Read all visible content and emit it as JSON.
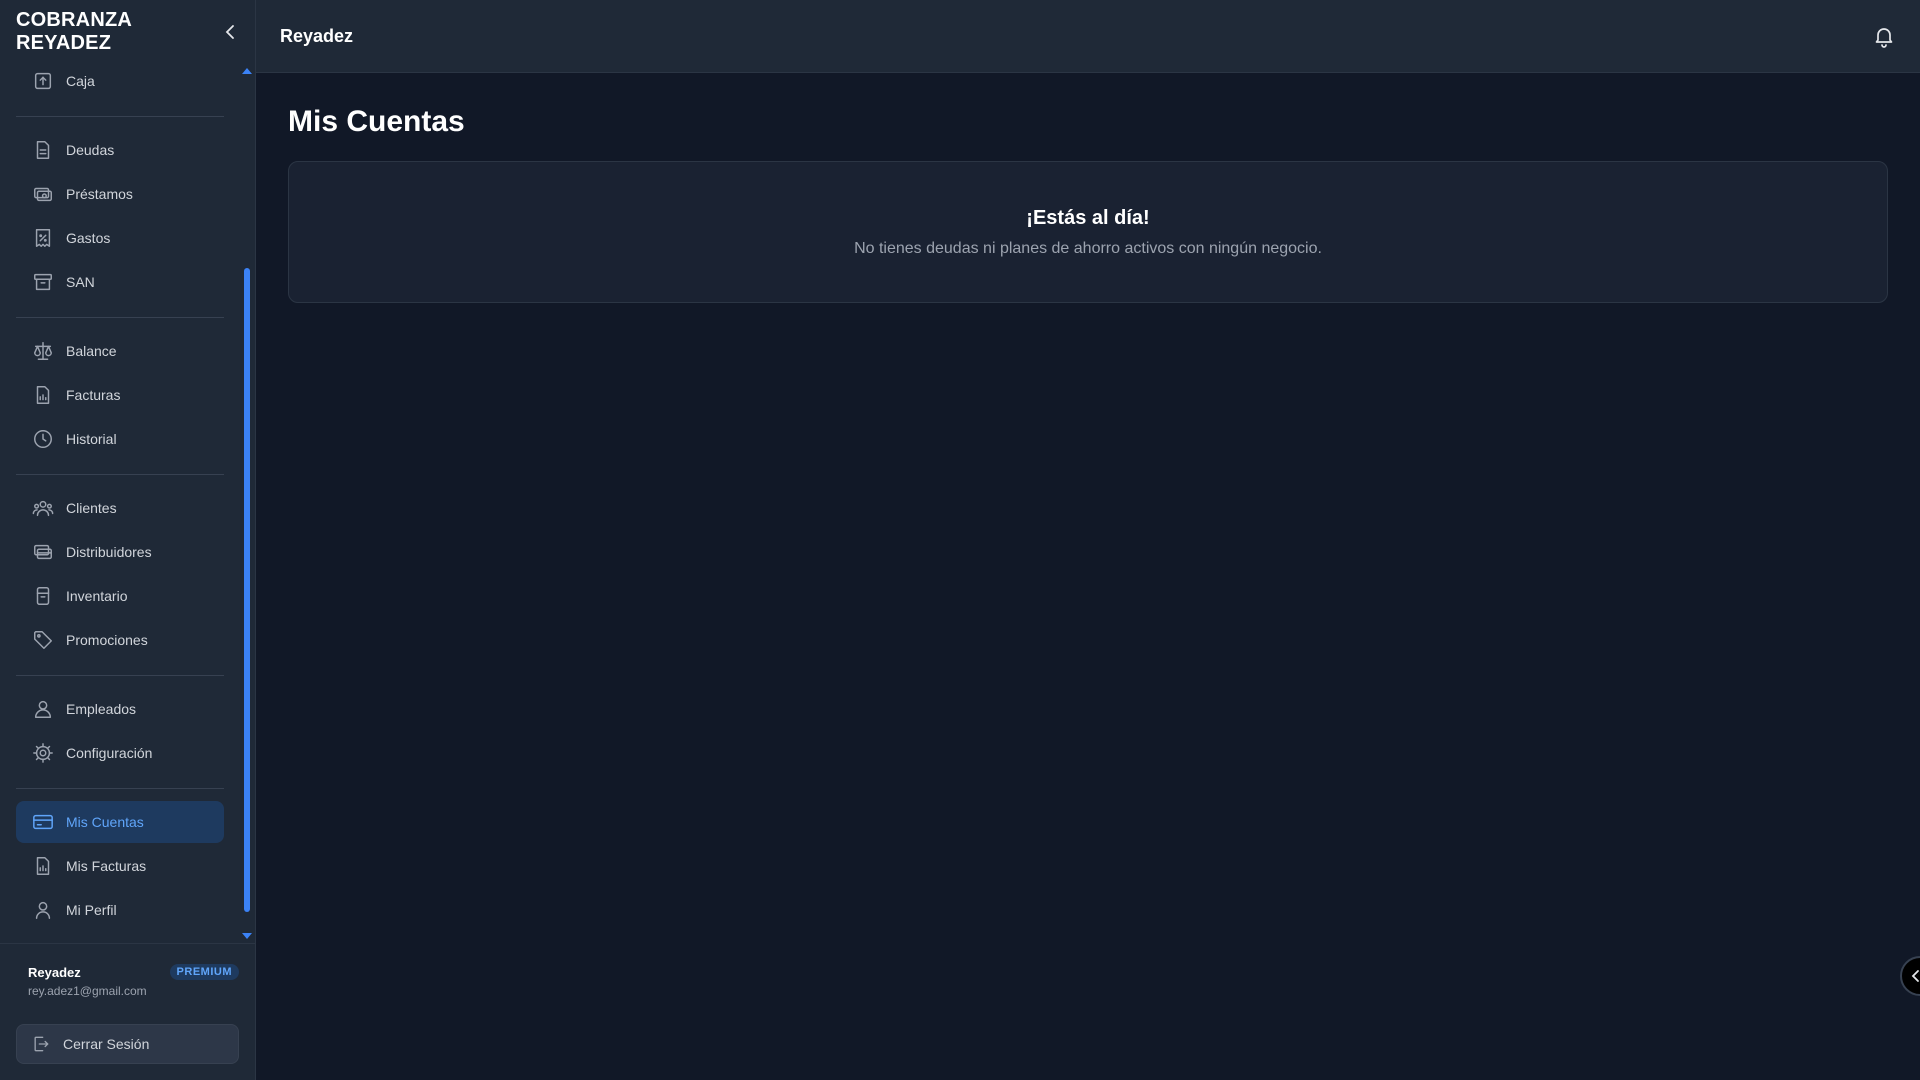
{
  "brand": {
    "title": "COBRANZA REYADEZ"
  },
  "topbar": {
    "title": "Reyadez"
  },
  "sidebar": {
    "groups": [
      [
        {
          "label": "Caja",
          "icon": "cash-register-icon"
        }
      ],
      [
        {
          "label": "Deudas",
          "icon": "document-icon"
        },
        {
          "label": "Préstamos",
          "icon": "money-icon"
        },
        {
          "label": "Gastos",
          "icon": "receipt-icon"
        },
        {
          "label": "SAN",
          "icon": "archive-icon"
        }
      ],
      [
        {
          "label": "Balance",
          "icon": "scale-icon"
        },
        {
          "label": "Facturas",
          "icon": "invoice-chart-icon"
        },
        {
          "label": "Historial",
          "icon": "clock-icon"
        }
      ],
      [
        {
          "label": "Clientes",
          "icon": "users-icon"
        },
        {
          "label": "Distribuidores",
          "icon": "cards-icon"
        },
        {
          "label": "Inventario",
          "icon": "box-icon"
        },
        {
          "label": "Promociones",
          "icon": "tag-icon"
        }
      ],
      [
        {
          "label": "Empleados",
          "icon": "employee-icon"
        },
        {
          "label": "Configuración",
          "icon": "gear-icon"
        }
      ],
      [
        {
          "label": "Mis Cuentas",
          "icon": "credit-card-icon",
          "active": true
        },
        {
          "label": "Mis Facturas",
          "icon": "invoice-chart-icon"
        },
        {
          "label": "Mi Perfil",
          "icon": "user-icon"
        }
      ]
    ]
  },
  "user": {
    "name": "Reyadez",
    "plan": "PREMIUM",
    "email": "rey.adez1@gmail.com"
  },
  "logout": {
    "label": "Cerrar Sesión"
  },
  "main": {
    "page_title": "Mis Cuentas",
    "empty_state": {
      "title": "¡Estás al día!",
      "message": "No tienes deudas ni planes de ahorro activos con ningún negocio."
    }
  },
  "colors": {
    "accent": "#3b82f6",
    "active_bg": "#1e3a5f",
    "sidebar_bg": "#1f2937",
    "page_bg": "#111827"
  }
}
